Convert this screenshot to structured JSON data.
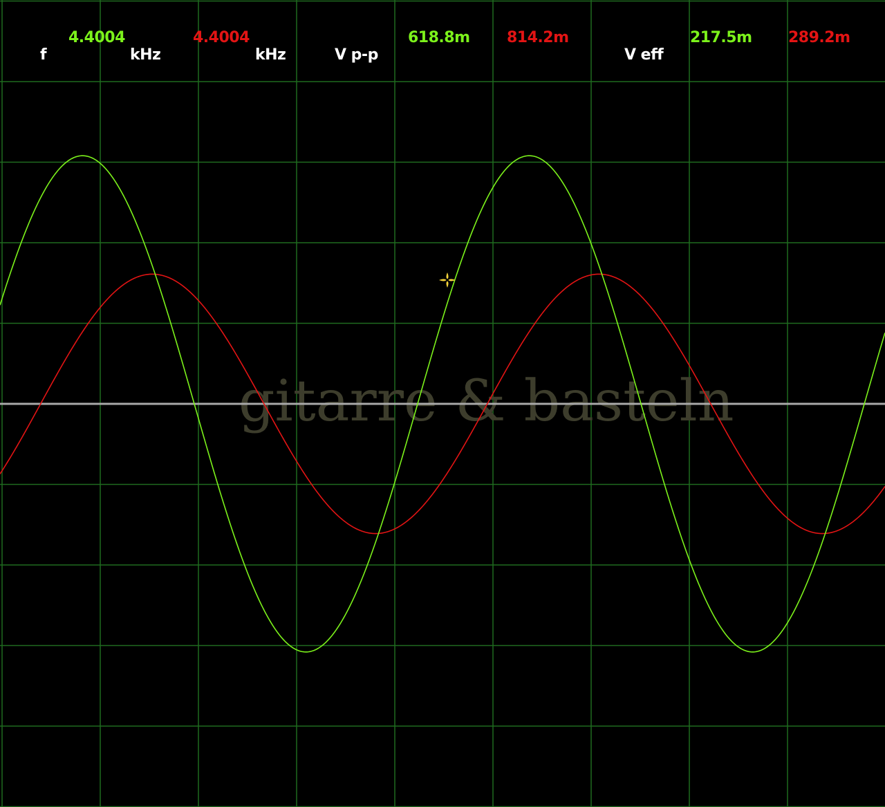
{
  "readouts": {
    "freq_label": "f",
    "freq_ch1": "4.4004",
    "freq_ch1_unit": "kHz",
    "freq_ch2": "4.4004",
    "freq_ch2_unit": "kHz",
    "vpp_label": "V p-p",
    "vpp_ch1": "618.8m",
    "vpp_ch2": "814.2m",
    "veff_label": "V eff",
    "veff_ch1": "217.5m",
    "veff_ch2": "289.2m"
  },
  "watermark": "gitarre & basteln",
  "colors": {
    "background": "#000000",
    "grid": "#1f6b1f",
    "ch1": "#7cf21b",
    "ch2": "#e31414",
    "center_line": "#a9a9a9",
    "label": "#ffffff",
    "watermark": "#3d3d2c",
    "cursor": "#f2d23a"
  },
  "icons": {
    "cursor": "crosshair-sparkle-icon"
  },
  "chart_data": {
    "type": "line",
    "grid": true,
    "series": [
      {
        "channel": "ch1",
        "frequency": "4.4004 kHz",
        "vpp": "618.8m",
        "veff": "217.5m",
        "peaks_x_divisions": [
          0.82,
          5.37
        ],
        "period_divisions": 4.55,
        "amplitude_divisions": 3.08
      },
      {
        "channel": "ch2",
        "frequency": "4.4004 kHz",
        "vpp": "814.2m",
        "veff": "289.2m",
        "peaks_x_divisions": [
          1.53,
          6.08
        ],
        "period_divisions": 4.55,
        "amplitude_divisions": 1.61
      }
    ]
  }
}
